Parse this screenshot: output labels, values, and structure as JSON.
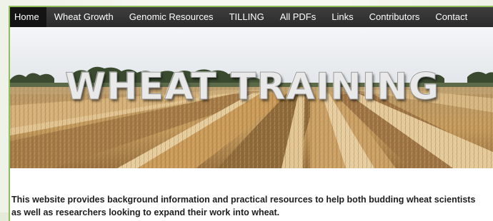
{
  "nav": {
    "items": [
      {
        "label": "Home",
        "active": true
      },
      {
        "label": "Wheat Growth",
        "active": false
      },
      {
        "label": "Genomic Resources",
        "active": false
      },
      {
        "label": "TILLING",
        "active": false
      },
      {
        "label": "All PDFs",
        "active": false
      },
      {
        "label": "Links",
        "active": false
      },
      {
        "label": "Contributors",
        "active": false
      },
      {
        "label": "Contact",
        "active": false
      }
    ]
  },
  "hero": {
    "title": "WHEAT TRAINING"
  },
  "intro": {
    "text": "This website provides background information and practical resources to help both budding wheat scientists as well as researchers looking to expand their work into wheat."
  },
  "colors": {
    "nav_bg": "#333333",
    "nav_active": "#141414",
    "page_border": "#8fbf5a"
  }
}
